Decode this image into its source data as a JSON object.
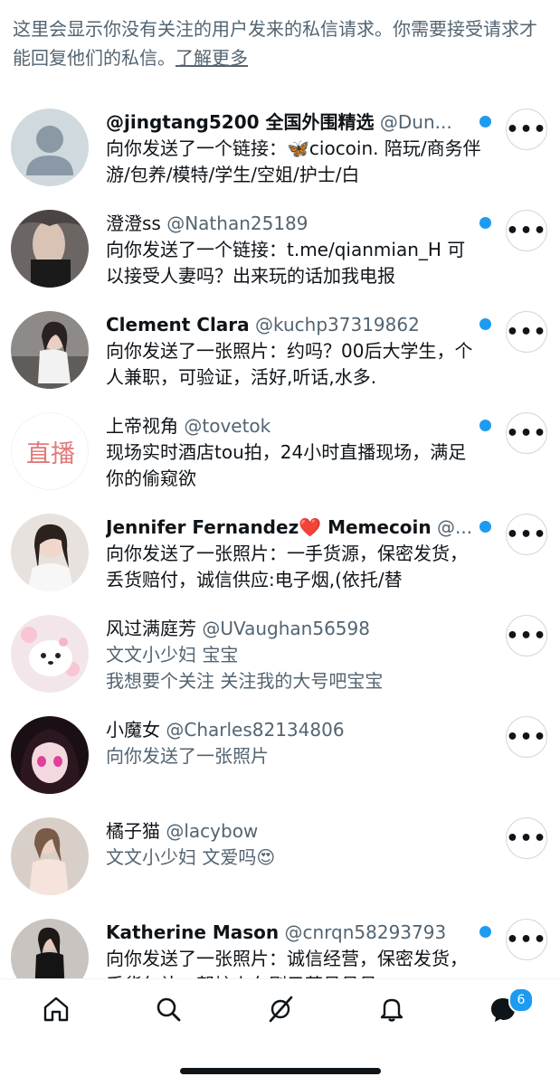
{
  "intro": {
    "text": "这里会显示你没有关注的用户发来的私信请求。你需要接受请求才能回复他们的私信。",
    "learn_more": "了解更多"
  },
  "requests": [
    {
      "name": "@jingtang5200 全国外围精选",
      "handle": "@Dun...",
      "message": "向你发送了一个链接：🦋ciocoin. 陪玩/商务伴游/包养/模特/学生/空姐/护士/白",
      "unread": true,
      "avatar": "default-avatar"
    },
    {
      "name": "澄澄ss",
      "handle": "@Nathan25189",
      "message": "向你发送了一个链接：t.me/qianmian_H 可以接受人妻吗？出来玩的话加我电报",
      "unread": true,
      "avatar": "photo-avatar"
    },
    {
      "name": "Clement Clara",
      "handle": "@kuchp37319862",
      "message": "向你发送了一张照片：约吗？00后大学生，个人兼职，可验证，活好,听话,水多.",
      "unread": true,
      "avatar": "photo-avatar"
    },
    {
      "name": "上帝视角",
      "handle": "@tovetok",
      "message": "现场实时酒店tou拍，24小时直播现场，满足你的偷窥欲",
      "unread": true,
      "avatar": "zhibo-logo",
      "avatar_text": "直播"
    },
    {
      "name": "Jennifer Fernandez❤️ Memecoin",
      "handle": "@...",
      "message": "向你发送了一张照片：一手货源，保密发货，丢货赔付，诚信供应:电子烟,(依托/替",
      "unread": true,
      "avatar": "photo-avatar"
    },
    {
      "name": "风过满庭芳",
      "handle": "@UVaughan56598",
      "message": "文文小少妇 宝宝\n我想要个关注 关注我的大号吧宝宝",
      "unread": false,
      "avatar": "dog-avatar"
    },
    {
      "name": "小魔女",
      "handle": "@Charles82134806",
      "message": "向你发送了一张照片",
      "unread": false,
      "avatar": "anime-avatar"
    },
    {
      "name": "橘子猫",
      "handle": "@lacybow",
      "message": "文文小少妇 文爱吗😍",
      "unread": false,
      "avatar": "photo-avatar"
    },
    {
      "name": "Katherine Mason",
      "handle": "@cnrqn58293793",
      "message": "向你发送了一张照片：诚信经营，保密发货，丢货包补，帮忙上车刷弓莱号号号",
      "unread": true,
      "avatar": "photo-avatar"
    }
  ],
  "more_glyph": "•••",
  "tabbar": {
    "tabs": [
      {
        "name": "home-tab",
        "icon": "home-icon"
      },
      {
        "name": "search-tab",
        "icon": "search-icon"
      },
      {
        "name": "grok-tab",
        "icon": "grok-icon"
      },
      {
        "name": "notifications-tab",
        "icon": "bell-icon"
      },
      {
        "name": "messages-tab",
        "icon": "envelope-icon"
      }
    ],
    "messages_badge": "6"
  },
  "colors": {
    "accent": "#1d9bf0",
    "text": "#0f1419",
    "secondary": "#536471",
    "border": "#cfd9de"
  }
}
